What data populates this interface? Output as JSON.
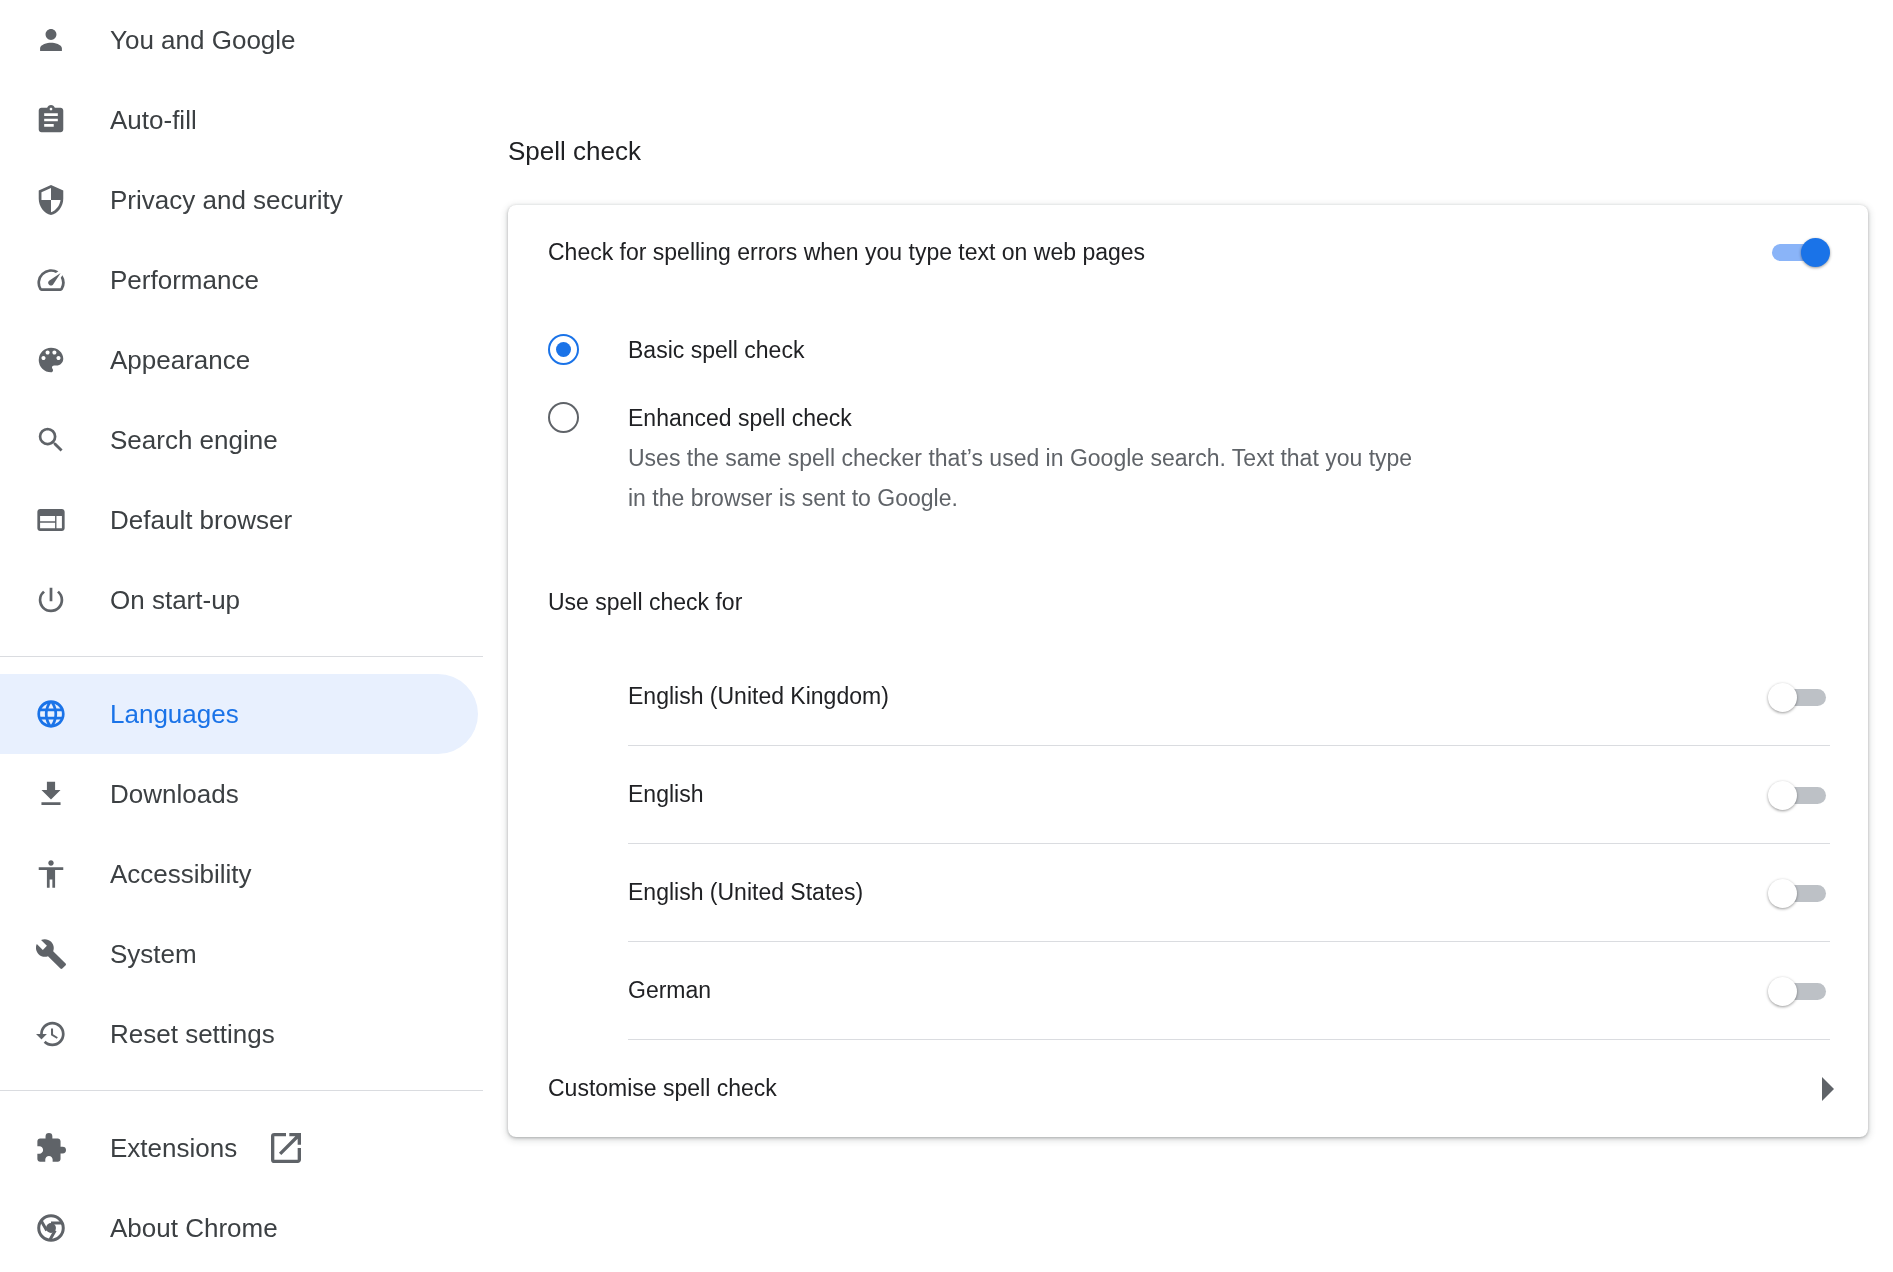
{
  "sidebar": {
    "groups": [
      [
        {
          "label": "You and Google",
          "selected": false,
          "kind": "page"
        },
        {
          "label": "Auto-fill",
          "selected": false,
          "kind": "page"
        },
        {
          "label": "Privacy and security",
          "selected": false,
          "kind": "page"
        },
        {
          "label": "Performance",
          "selected": false,
          "kind": "page"
        },
        {
          "label": "Appearance",
          "selected": false,
          "kind": "page"
        },
        {
          "label": "Search engine",
          "selected": false,
          "kind": "page"
        },
        {
          "label": "Default browser",
          "selected": false,
          "kind": "page"
        },
        {
          "label": "On start-up",
          "selected": false,
          "kind": "page"
        }
      ],
      [
        {
          "label": "Languages",
          "selected": true,
          "kind": "page"
        },
        {
          "label": "Downloads",
          "selected": false,
          "kind": "page"
        },
        {
          "label": "Accessibility",
          "selected": false,
          "kind": "page"
        },
        {
          "label": "System",
          "selected": false,
          "kind": "page"
        },
        {
          "label": "Reset settings",
          "selected": false,
          "kind": "page"
        }
      ],
      [
        {
          "label": "Extensions",
          "selected": false,
          "kind": "external"
        },
        {
          "label": "About Chrome",
          "selected": false,
          "kind": "page"
        }
      ]
    ]
  },
  "spell_check": {
    "heading": "Spell check",
    "toggle": {
      "label": "Check for spelling errors when you type text on web pages",
      "on": true
    },
    "modes": [
      {
        "label": "Basic spell check",
        "selected": true
      },
      {
        "label": "Enhanced spell check",
        "description": "Uses the same spell checker that’s used in Google search. Text that you type in the browser is sent to Google.",
        "selected": false
      }
    ],
    "languages_heading": "Use spell check for",
    "languages": [
      {
        "name": "English (United Kingdom)",
        "on": false
      },
      {
        "name": "English",
        "on": false
      },
      {
        "name": "English (United States)",
        "on": false
      },
      {
        "name": "German",
        "on": false
      }
    ],
    "customise": {
      "label": "Customise spell check"
    }
  }
}
